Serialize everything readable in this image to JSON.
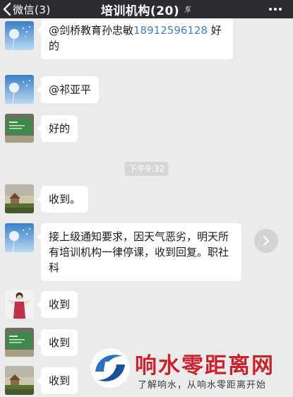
{
  "nav": {
    "back_label": "微信(3)",
    "title": "培训机构(20)",
    "muted": true
  },
  "messages": [
    {
      "sender_avatar": "dandelion-avatar",
      "text_prefix": "@剑桥教育孙忠敏",
      "phone": "18912596128",
      "text_suffix": " 好的"
    },
    {
      "sender_avatar": "dandelion-avatar",
      "text": "@祁亚平"
    },
    {
      "sender_avatar": "green-board-avatar",
      "text": "好的"
    },
    {
      "sender_avatar": "landscape-avatar",
      "text": "收到。"
    },
    {
      "sender_avatar": "dandelion-avatar",
      "text": "接上级通知要求，因天气恶劣，明天所有培训机构一律停课，收到回复。职社科"
    },
    {
      "sender_avatar": "woman-red-avatar",
      "text": "收到"
    },
    {
      "sender_avatar": "green-board-avatar",
      "text": "收到"
    },
    {
      "sender_avatar": "landscape-avatar",
      "text": "收到"
    }
  ],
  "time_divider": "下午9:32",
  "watermark": {
    "title": "响水零距离网",
    "slogan": "了解响水，从响水零距离开始"
  },
  "colors": {
    "navbar_bg": "#2d2d31",
    "chat_bg": "#ebebeb",
    "link": "#4a7ec0",
    "watermark_red": "#d0202a",
    "watermark_blue": "#2a6fc0"
  }
}
